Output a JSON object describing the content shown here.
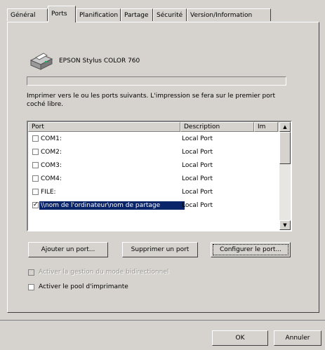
{
  "tabs": [
    "Général",
    "Ports",
    "Planification",
    "Partage",
    "Sécurité",
    "Version/Information"
  ],
  "printer": {
    "name": "EPSON Stylus COLOR 760",
    "name_field_value": ""
  },
  "instructions": "Imprimer vers le ou les ports suivants. L'impression se fera sur le premier port coché libre.",
  "port_list": {
    "columns": [
      "Port",
      "Description",
      "Im"
    ],
    "rows": [
      {
        "port": "COM1:",
        "description": "Local Port",
        "checked": false,
        "selected": false
      },
      {
        "port": "COM2:",
        "description": "Local Port",
        "checked": false,
        "selected": false
      },
      {
        "port": "COM3:",
        "description": "Local Port",
        "checked": false,
        "selected": false
      },
      {
        "port": "COM4:",
        "description": "Local Port",
        "checked": false,
        "selected": false
      },
      {
        "port": "FILE:",
        "description": "Local Port",
        "checked": false,
        "selected": false
      },
      {
        "port": "\\\\nom de l'ordinateur\\nom de partage",
        "description": "Local Port",
        "checked": true,
        "selected": true
      }
    ]
  },
  "buttons": {
    "add_port": "Ajouter un port...",
    "delete_port": "Supprimer un port",
    "configure_port": "Configurer le port...",
    "ok": "OK",
    "cancel": "Annuler"
  },
  "options": {
    "bidirectional": {
      "label": "Activer la gestion du mode bidirectionnel",
      "checked": false,
      "enabled": false
    },
    "pool": {
      "label": "Activer le pool d'imprimante",
      "checked": false,
      "enabled": true
    }
  }
}
